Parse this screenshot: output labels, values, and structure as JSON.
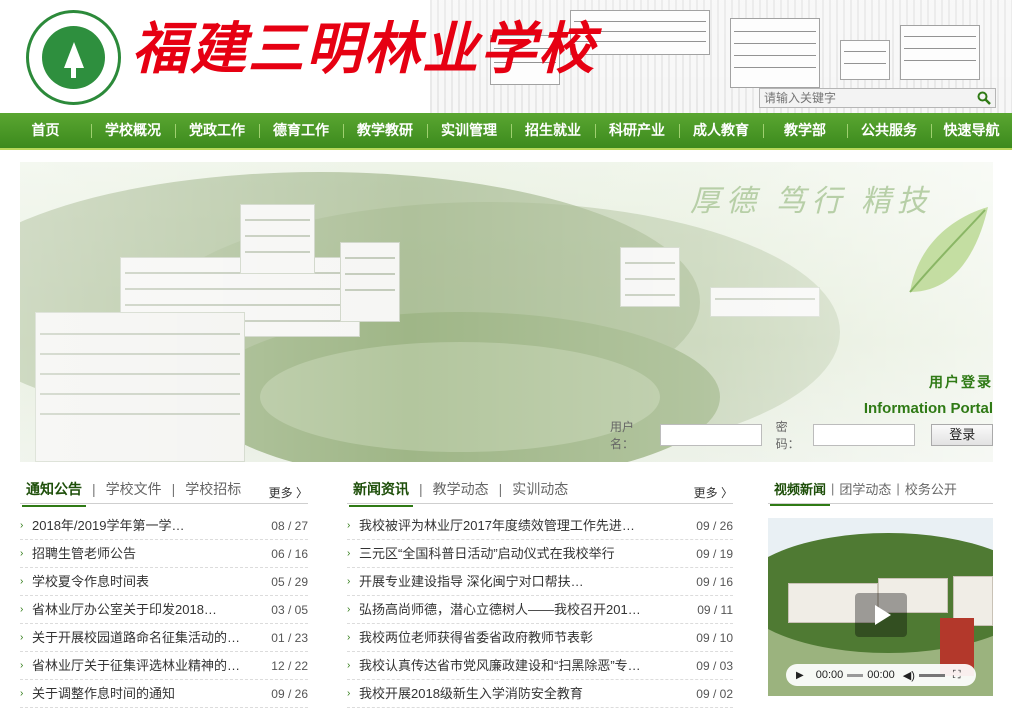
{
  "header": {
    "school_name": "福建三明林业学校",
    "search_placeholder": "请输入关键字"
  },
  "nav": {
    "items": [
      "首页",
      "学校概况",
      "党政工作",
      "德育工作",
      "教学教研",
      "实训管理",
      "招生就业",
      "科研产业",
      "成人教育",
      "教学部",
      "公共服务",
      "快速导航"
    ]
  },
  "banner": {
    "slogan": "厚德 笃行 精技",
    "login_title_cn": "用户登录",
    "login_title_en": "Information Portal",
    "username_label": "用户名：",
    "password_label": "密码：",
    "login_button": "登录"
  },
  "notices": {
    "tabs": [
      "通知公告",
      "学校文件",
      "学校招标"
    ],
    "more": "更多 〉",
    "items": [
      {
        "title": "2018年/2019学年第一学…",
        "date": "08 / 27"
      },
      {
        "title": "招聘生管老师公告",
        "date": "06 / 16"
      },
      {
        "title": "学校夏令作息时间表",
        "date": "05 / 29"
      },
      {
        "title": "省林业厅办公室关于印发2018…",
        "date": "03 / 05"
      },
      {
        "title": "关于开展校园道路命名征集活动的…",
        "date": "01 / 23"
      },
      {
        "title": "省林业厅关于征集评选林业精神的…",
        "date": "12 / 22"
      },
      {
        "title": "关于调整作息时间的通知",
        "date": "09 / 26"
      }
    ]
  },
  "news": {
    "tabs": [
      "新闻资讯",
      "教学动态",
      "实训动态"
    ],
    "more": "更多 〉",
    "items": [
      {
        "title": "我校被评为林业厅2017年度绩效管理工作先进…",
        "date": "09 / 26"
      },
      {
        "title": "三元区“全国科普日活动”启动仪式在我校举行",
        "date": "09 / 19"
      },
      {
        "title": "开展专业建设指导 深化闽宁对口帮扶…",
        "date": "09 / 16"
      },
      {
        "title": "弘扬高尚师德，潜心立德树人——我校召开201…",
        "date": "09 / 11"
      },
      {
        "title": "我校两位老师获得省委省政府教师节表彰",
        "date": "09 / 10"
      },
      {
        "title": "我校认真传达省市党风廉政建设和“扫黑除恶”专…",
        "date": "09 / 03"
      },
      {
        "title": "我校开展2018级新生入学消防安全教育",
        "date": "09 / 02"
      }
    ]
  },
  "video_section": {
    "tabs": [
      "视频新闻",
      "团学动态",
      "校务公开"
    ],
    "time_current": "00:00",
    "time_total": "00:00"
  }
}
